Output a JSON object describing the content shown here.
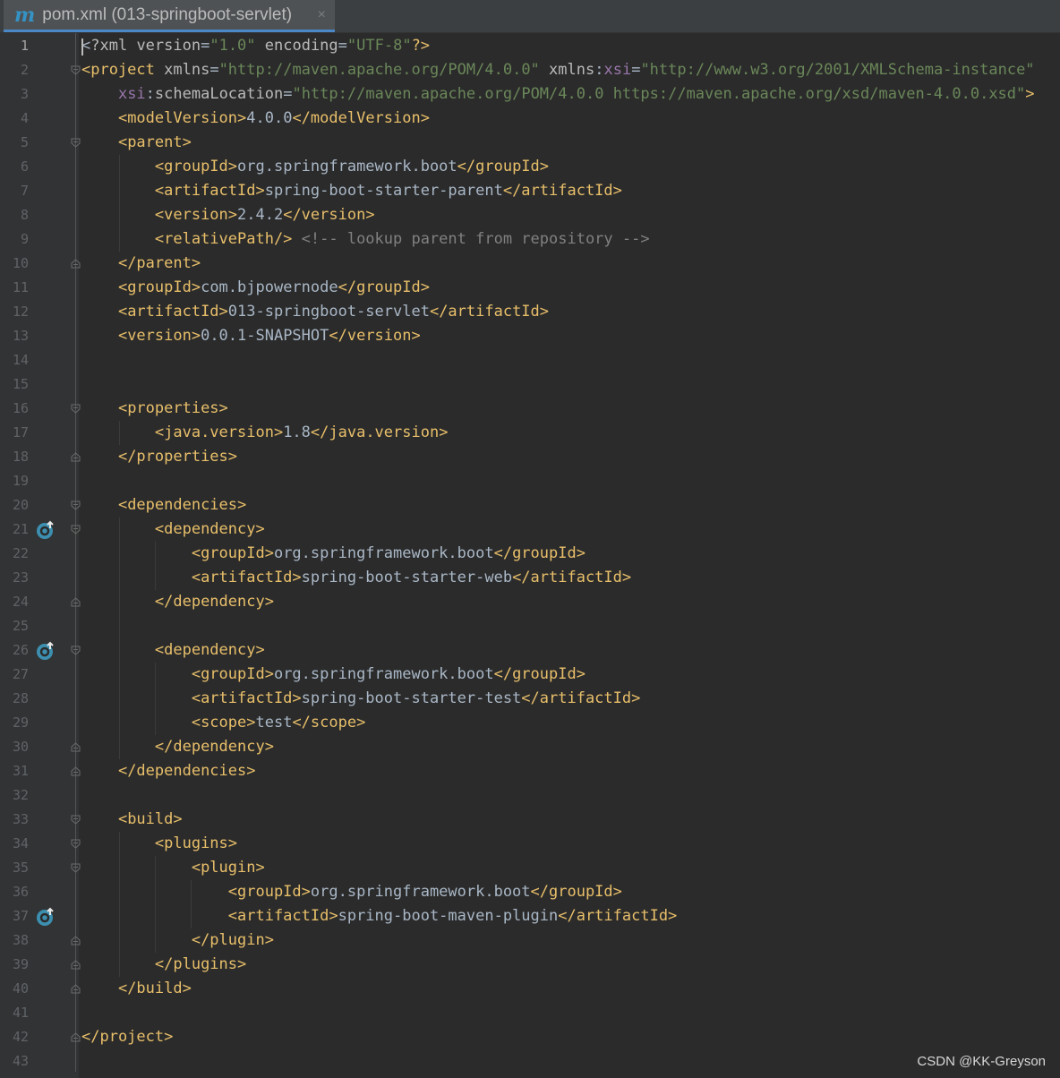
{
  "tab": {
    "icon": "maven-m-icon",
    "title": "pom.xml (013-springboot-servlet)",
    "close": "×"
  },
  "editor": {
    "lines": [
      {
        "num": "1",
        "code": [
          [
            "x",
            "<"
          ],
          [
            "a",
            "?xml "
          ],
          [
            "a",
            "version"
          ],
          [
            "x",
            "="
          ],
          [
            "s",
            "\"1.0\""
          ],
          [
            "a",
            " encoding"
          ],
          [
            "x",
            "="
          ],
          [
            "s",
            "\"UTF-8\""
          ],
          [
            "t",
            "?>"
          ]
        ]
      },
      {
        "num": "2",
        "code": [
          [
            "t",
            "<project "
          ],
          [
            "a",
            "xmlns"
          ],
          [
            "x",
            "="
          ],
          [
            "s",
            "\"http://maven.apache.org/POM/4.0.0\""
          ],
          [
            "a",
            " xmlns"
          ],
          [
            "x",
            ":"
          ],
          [
            "ns",
            "xsi"
          ],
          [
            "x",
            "="
          ],
          [
            "s",
            "\"http://www.w3.org/2001/XMLSchema-instance\""
          ]
        ]
      },
      {
        "num": "3",
        "code": [
          [
            "x",
            "    "
          ],
          [
            "ns",
            "xsi"
          ],
          [
            "x",
            ":"
          ],
          [
            "a",
            "schemaLocation"
          ],
          [
            "x",
            "="
          ],
          [
            "s",
            "\"http://maven.apache.org/POM/4.0.0 https://maven.apache.org/xsd/maven-4.0.0.xsd\""
          ],
          [
            "t",
            ">"
          ]
        ]
      },
      {
        "num": "4",
        "code": [
          [
            "x",
            "    "
          ],
          [
            "t",
            "<modelVersion>"
          ],
          [
            "x",
            "4.0.0"
          ],
          [
            "t",
            "</modelVersion>"
          ]
        ]
      },
      {
        "num": "5",
        "code": [
          [
            "x",
            "    "
          ],
          [
            "t",
            "<parent>"
          ]
        ]
      },
      {
        "num": "6",
        "code": [
          [
            "x",
            "        "
          ],
          [
            "t",
            "<groupId>"
          ],
          [
            "x",
            "org.springframework.boot"
          ],
          [
            "t",
            "</groupId>"
          ]
        ]
      },
      {
        "num": "7",
        "code": [
          [
            "x",
            "        "
          ],
          [
            "t",
            "<artifactId>"
          ],
          [
            "x",
            "spring-boot-starter-parent"
          ],
          [
            "t",
            "</artifactId>"
          ]
        ]
      },
      {
        "num": "8",
        "code": [
          [
            "x",
            "        "
          ],
          [
            "t",
            "<version>"
          ],
          [
            "x",
            "2.4.2"
          ],
          [
            "t",
            "</version>"
          ]
        ]
      },
      {
        "num": "9",
        "code": [
          [
            "x",
            "        "
          ],
          [
            "t",
            "<relativePath/>"
          ],
          [
            "c",
            " <!-- lookup parent from repository -->"
          ]
        ]
      },
      {
        "num": "10",
        "code": [
          [
            "x",
            "    "
          ],
          [
            "t",
            "</parent>"
          ]
        ]
      },
      {
        "num": "11",
        "code": [
          [
            "x",
            "    "
          ],
          [
            "t",
            "<groupId>"
          ],
          [
            "x",
            "com.bjpowernode"
          ],
          [
            "t",
            "</groupId>"
          ]
        ]
      },
      {
        "num": "12",
        "code": [
          [
            "x",
            "    "
          ],
          [
            "t",
            "<artifactId>"
          ],
          [
            "x",
            "013-springboot-servlet"
          ],
          [
            "t",
            "</artifactId>"
          ]
        ]
      },
      {
        "num": "13",
        "code": [
          [
            "x",
            "    "
          ],
          [
            "t",
            "<version>"
          ],
          [
            "x",
            "0.0.1-SNAPSHOT"
          ],
          [
            "t",
            "</version>"
          ]
        ]
      },
      {
        "num": "14",
        "code": []
      },
      {
        "num": "15",
        "code": []
      },
      {
        "num": "16",
        "code": [
          [
            "x",
            "    "
          ],
          [
            "t",
            "<properties>"
          ]
        ]
      },
      {
        "num": "17",
        "code": [
          [
            "x",
            "        "
          ],
          [
            "t",
            "<java.version>"
          ],
          [
            "x",
            "1.8"
          ],
          [
            "t",
            "</java.version>"
          ]
        ]
      },
      {
        "num": "18",
        "code": [
          [
            "x",
            "    "
          ],
          [
            "t",
            "</properties>"
          ]
        ]
      },
      {
        "num": "19",
        "code": []
      },
      {
        "num": "20",
        "code": [
          [
            "x",
            "    "
          ],
          [
            "t",
            "<dependencies>"
          ]
        ]
      },
      {
        "num": "21",
        "code": [
          [
            "x",
            "        "
          ],
          [
            "t",
            "<dependency>"
          ]
        ]
      },
      {
        "num": "22",
        "code": [
          [
            "x",
            "            "
          ],
          [
            "t",
            "<groupId>"
          ],
          [
            "x",
            "org.springframework.boot"
          ],
          [
            "t",
            "</groupId>"
          ]
        ]
      },
      {
        "num": "23",
        "code": [
          [
            "x",
            "            "
          ],
          [
            "t",
            "<artifactId>"
          ],
          [
            "x",
            "spring-boot-starter-web"
          ],
          [
            "t",
            "</artifactId>"
          ]
        ]
      },
      {
        "num": "24",
        "code": [
          [
            "x",
            "        "
          ],
          [
            "t",
            "</dependency>"
          ]
        ]
      },
      {
        "num": "25",
        "code": []
      },
      {
        "num": "26",
        "code": [
          [
            "x",
            "        "
          ],
          [
            "t",
            "<dependency>"
          ]
        ]
      },
      {
        "num": "27",
        "code": [
          [
            "x",
            "            "
          ],
          [
            "t",
            "<groupId>"
          ],
          [
            "x",
            "org.springframework.boot"
          ],
          [
            "t",
            "</groupId>"
          ]
        ]
      },
      {
        "num": "28",
        "code": [
          [
            "x",
            "            "
          ],
          [
            "t",
            "<artifactId>"
          ],
          [
            "x",
            "spring-boot-starter-test"
          ],
          [
            "t",
            "</artifactId>"
          ]
        ]
      },
      {
        "num": "29",
        "code": [
          [
            "x",
            "            "
          ],
          [
            "t",
            "<scope>"
          ],
          [
            "x",
            "test"
          ],
          [
            "t",
            "</scope>"
          ]
        ]
      },
      {
        "num": "30",
        "code": [
          [
            "x",
            "        "
          ],
          [
            "t",
            "</dependency>"
          ]
        ]
      },
      {
        "num": "31",
        "code": [
          [
            "x",
            "    "
          ],
          [
            "t",
            "</dependencies>"
          ]
        ]
      },
      {
        "num": "32",
        "code": []
      },
      {
        "num": "33",
        "code": [
          [
            "x",
            "    "
          ],
          [
            "t",
            "<build>"
          ]
        ]
      },
      {
        "num": "34",
        "code": [
          [
            "x",
            "        "
          ],
          [
            "t",
            "<plugins>"
          ]
        ]
      },
      {
        "num": "35",
        "code": [
          [
            "x",
            "            "
          ],
          [
            "t",
            "<plugin>"
          ]
        ]
      },
      {
        "num": "36",
        "code": [
          [
            "x",
            "                "
          ],
          [
            "t",
            "<groupId>"
          ],
          [
            "x",
            "org.springframework.boot"
          ],
          [
            "t",
            "</groupId>"
          ]
        ]
      },
      {
        "num": "37",
        "code": [
          [
            "x",
            "                "
          ],
          [
            "t",
            "<artifactId>"
          ],
          [
            "x",
            "spring-boot-maven-plugin"
          ],
          [
            "t",
            "</artifactId>"
          ]
        ]
      },
      {
        "num": "38",
        "code": [
          [
            "x",
            "            "
          ],
          [
            "t",
            "</plugin>"
          ]
        ]
      },
      {
        "num": "39",
        "code": [
          [
            "x",
            "        "
          ],
          [
            "t",
            "</plugins>"
          ]
        ]
      },
      {
        "num": "40",
        "code": [
          [
            "x",
            "    "
          ],
          [
            "t",
            "</build>"
          ]
        ]
      },
      {
        "num": "41",
        "code": []
      },
      {
        "num": "42",
        "code": [
          [
            "t",
            "</project>"
          ]
        ]
      },
      {
        "num": "43",
        "code": []
      }
    ]
  },
  "watermark": "CSDN @KK-Greyson"
}
